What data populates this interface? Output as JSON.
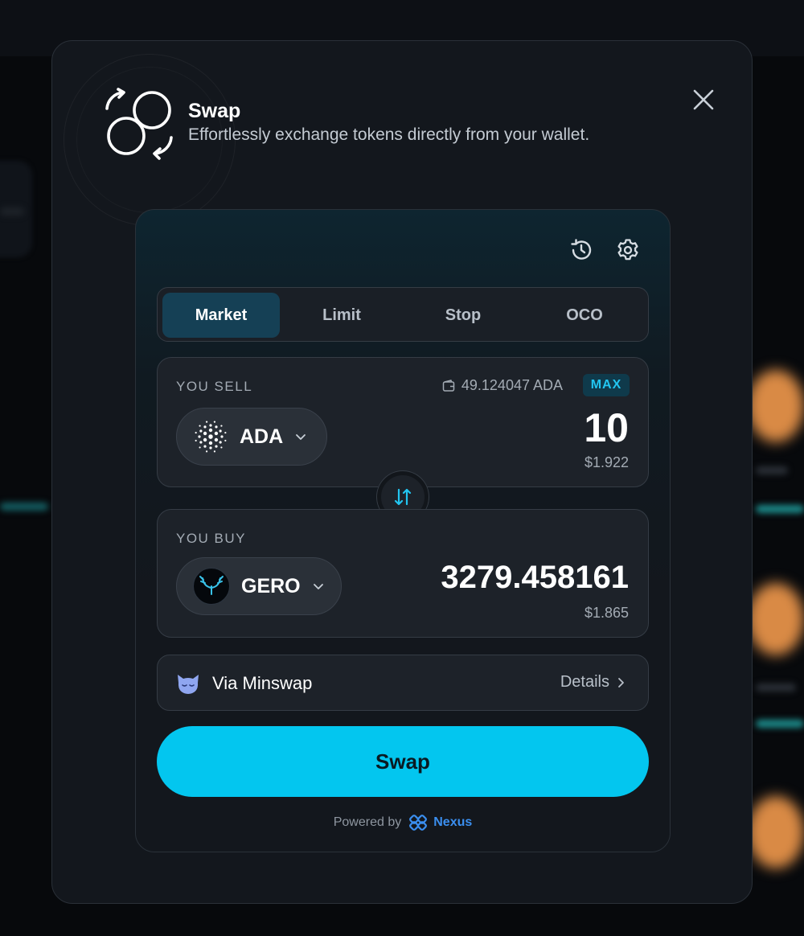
{
  "modal": {
    "title": "Swap",
    "subtitle": "Effortlessly exchange tokens directly from your wallet."
  },
  "tabs": [
    {
      "label": "Market",
      "active": true
    },
    {
      "label": "Limit",
      "active": false
    },
    {
      "label": "Stop",
      "active": false
    },
    {
      "label": "OCO",
      "active": false
    }
  ],
  "sell": {
    "label": "YOU SELL",
    "balance": "49.124047 ADA",
    "max_label": "MAX",
    "token": "ADA",
    "amount": "10",
    "usd": "$1.922"
  },
  "buy": {
    "label": "YOU BUY",
    "token": "GERO",
    "amount": "3279.458161",
    "usd": "$1.865"
  },
  "route": {
    "label": "Via Minswap",
    "details_label": "Details"
  },
  "swap_button": "Swap",
  "footer": {
    "powered_by": "Powered by",
    "brand": "Nexus"
  },
  "icons": {
    "header": "swap-cycle-icon",
    "close": "close-icon",
    "history": "history-icon",
    "settings": "gear-icon",
    "balance": "wallet-icon",
    "flip": "swap-arrows-icon",
    "route": "minswap-logo-icon"
  },
  "colors": {
    "accent": "#03c6ef",
    "active_tab": "#154055",
    "max_badge": "#22c5f0",
    "brand": "#3b8ff0"
  }
}
